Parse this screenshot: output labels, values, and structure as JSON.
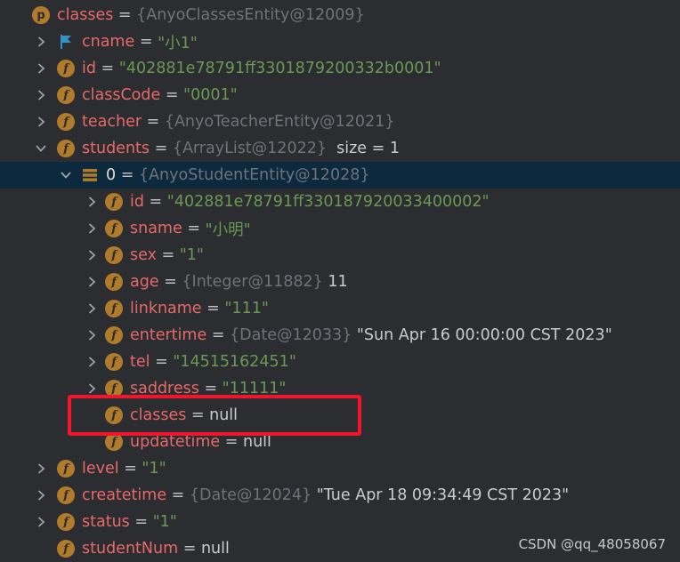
{
  "tree": {
    "rows": [
      {
        "name": "classes",
        "eq": " = ",
        "ref": "{AnyoClassesEntity@12009}",
        "icon": "p",
        "arrow": "down",
        "level": 0
      },
      {
        "name": "cname",
        "eq": " = ",
        "str": "\"小1\"",
        "icon": "flag",
        "arrow": "right",
        "level": 1
      },
      {
        "name": "id",
        "eq": " = ",
        "str": "\"402881e78791ff3301879200332b0001\"",
        "icon": "f",
        "arrow": "right",
        "level": 1
      },
      {
        "name": "classCode",
        "eq": " = ",
        "str": "\"0001\"",
        "icon": "f",
        "arrow": "right",
        "level": 1
      },
      {
        "name": "teacher",
        "eq": " = ",
        "ref": "{AnyoTeacherEntity@12021}",
        "icon": "f",
        "arrow": "right",
        "level": 1
      },
      {
        "name": "students",
        "eq": " = ",
        "ref": "{ArrayList@12022}",
        "plain": "  size = 1",
        "icon": "f",
        "arrow": "down",
        "level": 1
      },
      {
        "name": "0",
        "eq": " = ",
        "ref": "{AnyoStudentEntity@12028}",
        "icon": "array",
        "arrow": "down",
        "level": 2,
        "selected": true
      },
      {
        "name": "id",
        "eq": " = ",
        "str": "\"402881e78791ff330187920033400002\"",
        "icon": "f",
        "arrow": "right",
        "level": 3
      },
      {
        "name": "sname",
        "eq": " = ",
        "str": "\"小明\"",
        "icon": "f",
        "arrow": "right",
        "level": 3
      },
      {
        "name": "sex",
        "eq": " = ",
        "str": "\"1\"",
        "icon": "f",
        "arrow": "right",
        "level": 3
      },
      {
        "name": "age",
        "eq": " = ",
        "ref": "{Integer@11882}",
        "plain": " 11",
        "icon": "f",
        "arrow": "right",
        "level": 3
      },
      {
        "name": "linkname",
        "eq": " = ",
        "str": "\"111\"",
        "icon": "f",
        "arrow": "right",
        "level": 3
      },
      {
        "name": "entertime",
        "eq": " = ",
        "ref": "{Date@12033}",
        "plain": " \"Sun Apr 16 00:00:00 CST 2023\"",
        "icon": "f",
        "arrow": "right",
        "level": 3
      },
      {
        "name": "tel",
        "eq": " = ",
        "str": "\"14515162451\"",
        "icon": "f",
        "arrow": "right",
        "level": 3
      },
      {
        "name": "saddress",
        "eq": " = ",
        "str": "\"11111\"",
        "icon": "f",
        "arrow": "right",
        "level": 3
      },
      {
        "name": "classes",
        "eq": " = ",
        "plain": "null",
        "icon": "f",
        "arrow": "none",
        "level": 3
      },
      {
        "name": "updatetime",
        "eq": " = ",
        "plain": "null",
        "icon": "f",
        "arrow": "none",
        "level": 3
      },
      {
        "name": "level",
        "eq": " = ",
        "str": "\"1\"",
        "icon": "f",
        "arrow": "right",
        "level": 1
      },
      {
        "name": "createtime",
        "eq": " = ",
        "ref": "{Date@12024}",
        "plain": " \"Tue Apr 18 09:34:49 CST 2023\"",
        "icon": "f",
        "arrow": "right",
        "level": 1
      },
      {
        "name": "status",
        "eq": " = ",
        "str": "\"1\"",
        "icon": "f",
        "arrow": "right",
        "level": 1
      },
      {
        "name": "studentNum",
        "eq": " = ",
        "plain": "null",
        "icon": "f",
        "arrow": "none",
        "level": 1
      }
    ]
  },
  "icon_letters": {
    "p": "p",
    "f": "f"
  },
  "watermark": "CSDN @qq_48058067",
  "colors": {
    "background": "#2b2d30",
    "selected_row": "#0d293e",
    "field_name": "#e76a6a",
    "string_value": "#6a9955",
    "reference": "#6f737a",
    "icon_badge": "#b07b2a",
    "highlight_border": "#f2152b",
    "flag_icon": "#3592c4"
  }
}
